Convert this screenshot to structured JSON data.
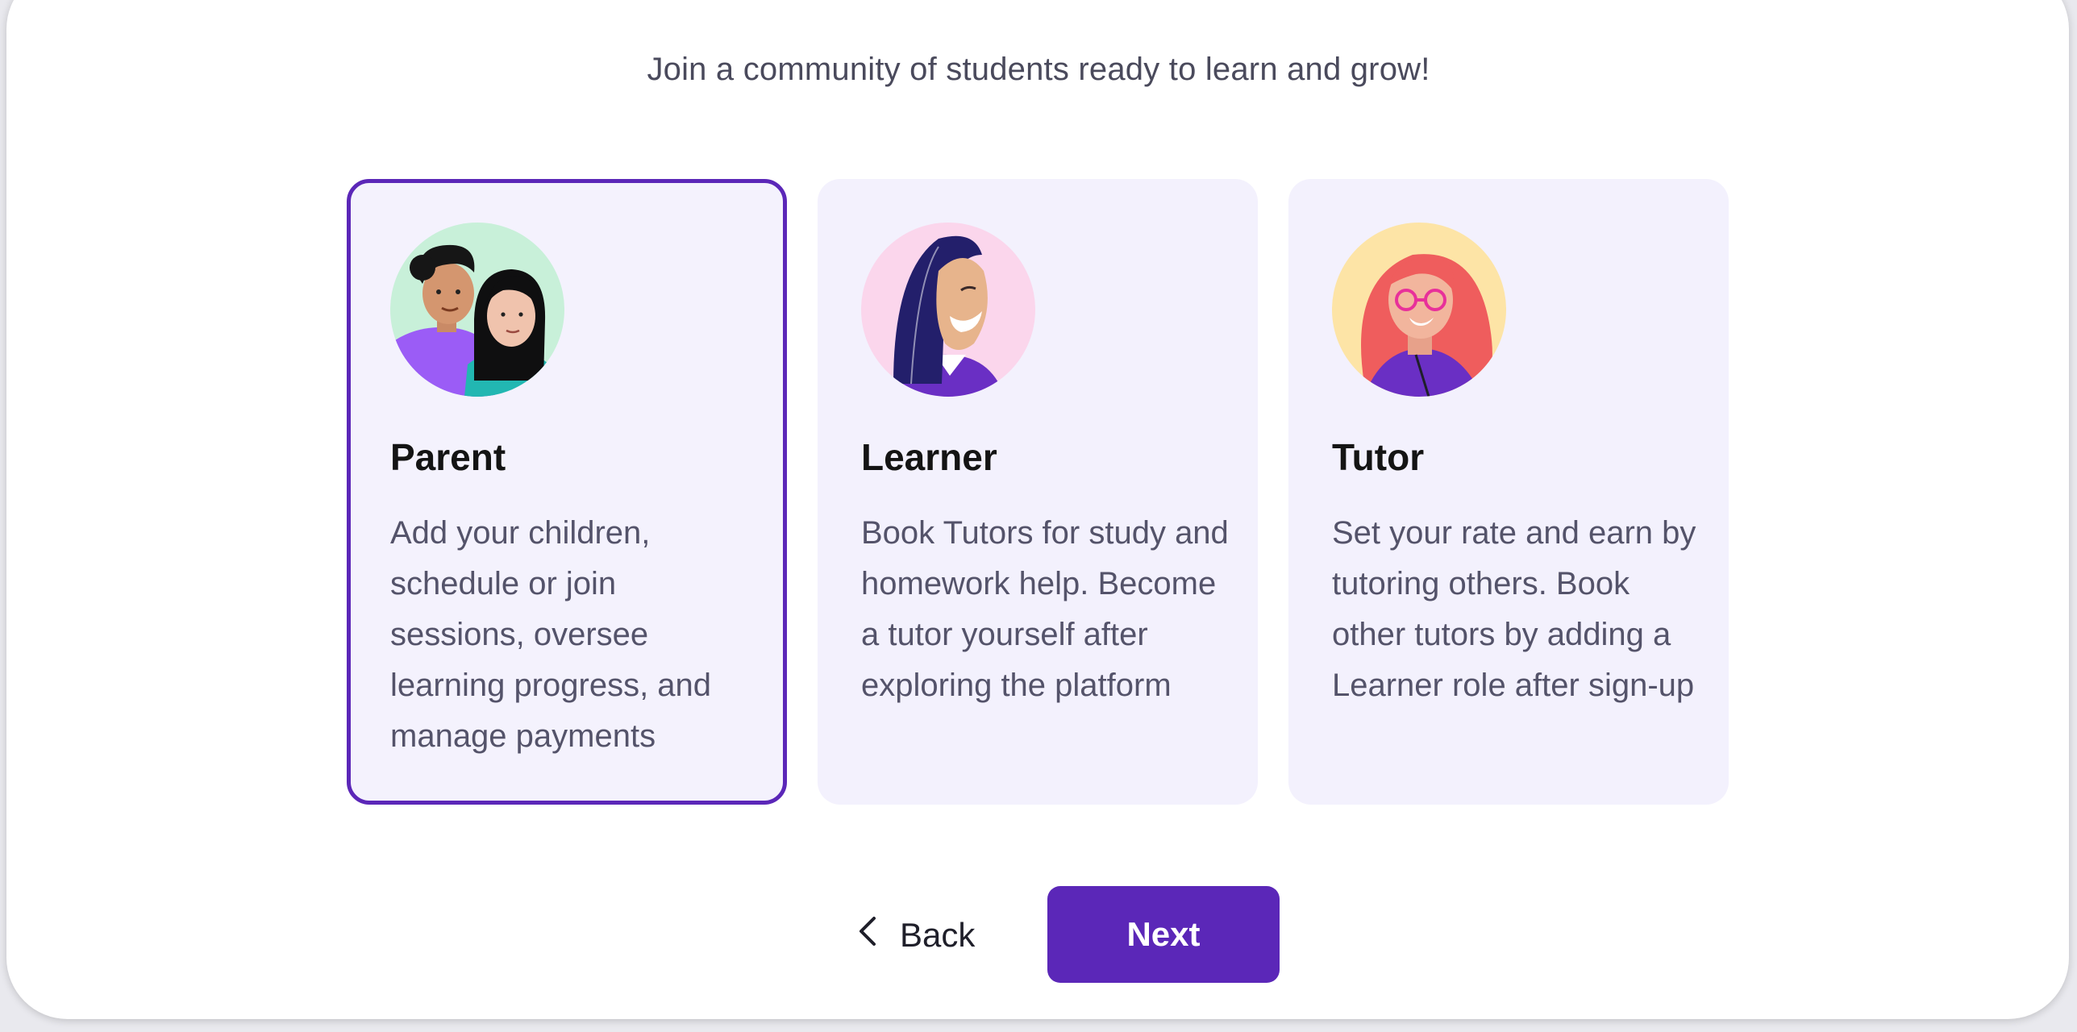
{
  "header": {
    "subtitle": "Join a community of students ready to learn and grow!"
  },
  "roles": [
    {
      "title": "Parent",
      "description": "Add your children, schedule or join sessions, oversee learning progress, and manage payments",
      "selected": true,
      "avatar": "parent-avatar-illustration",
      "avatar_bg": "#c8f0d9"
    },
    {
      "title": "Learner",
      "description": "Book Tutors for study and homework help. Become a tutor yourself after exploring the platform",
      "selected": false,
      "avatar": "learner-avatar-illustration",
      "avatar_bg": "#fbd6ec"
    },
    {
      "title": "Tutor",
      "description": "Set your rate and earn by tutoring others. Book other tutors by adding a Learner role after sign-up",
      "selected": false,
      "avatar": "tutor-avatar-illustration",
      "avatar_bg": "#fde4a6"
    }
  ],
  "actions": {
    "back_label": "Back",
    "back_icon": "chevron-left-icon",
    "next_label": "Next"
  },
  "colors": {
    "accent": "#5b27b8",
    "card_bg": "#f3f1fd"
  }
}
